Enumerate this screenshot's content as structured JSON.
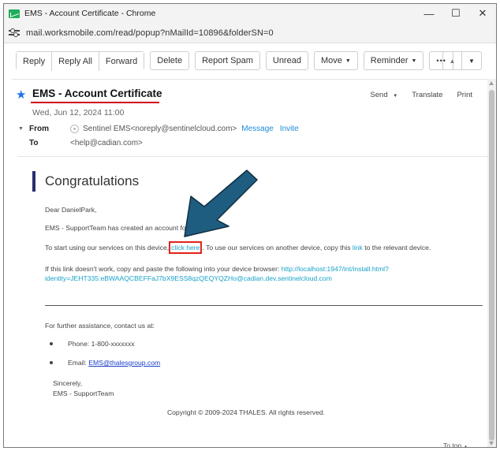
{
  "window": {
    "title": "EMS - Account Certificate - Chrome",
    "controls": {
      "minimize": "—",
      "maximize": "☐",
      "close": "✕"
    }
  },
  "address": {
    "url": "mail.worksmobile.com/read/popup?nMailId=10896&folderSN=0"
  },
  "toolbar": {
    "reply": "Reply",
    "reply_all": "Reply All",
    "forward": "Forward",
    "delete": "Delete",
    "report_spam": "Report Spam",
    "unread": "Unread",
    "move": "Move",
    "reminder": "Reminder",
    "more": "•••"
  },
  "mail": {
    "subject": "EMS - Account Certificate",
    "date": "Wed, Jun 12, 2024 11:00",
    "actions": {
      "send": "Send",
      "translate": "Translate",
      "print": "Print"
    },
    "from_label": "From",
    "from_sender": "Sentinel EMS<noreply@sentinelcloud.com>",
    "from_message": "Message",
    "from_invite": "Invite",
    "to_label": "To",
    "to_addr": "<help@cadian.com>"
  },
  "body": {
    "heading": "Congratulations",
    "greeting": "Dear DanielPark,",
    "created": "EMS - SupportTeam has created an account for you",
    "start_pre": "To start using our services on this device,",
    "click_here": "click here",
    "start_mid": ". To use our services on another device, copy this",
    "link_word": "link",
    "start_post": "to the relevant device.",
    "fallback_pre": "If this link doesn't work, copy and paste the following into your device browser:",
    "fallback_url_1": "http://localhost:1947/int/install.html?",
    "fallback_url_2": "identity=JEHT335:eBWAAQCBEFFaJ7bX9ESS8qzQEQYQZHo@cadian.dev.sentinelcloud.com",
    "assist": "For further assistance, contact us at:",
    "phone": "Phone: 1-800-xxxxxxx",
    "email_label": "Email:",
    "email": "EMS@thalesgroup.com",
    "sincerely": "Sincerely,",
    "signature": "EMS - SupportTeam",
    "copyright": "Copyright © 2009-2024 THALES. All rights reserved.",
    "to_top": "To top"
  },
  "colors": {
    "accent_link": "#17a2c8",
    "annotation_red": "#e0231b",
    "annotation_arrow": "#1f5d80",
    "heading_bar": "#2a2d6e"
  }
}
